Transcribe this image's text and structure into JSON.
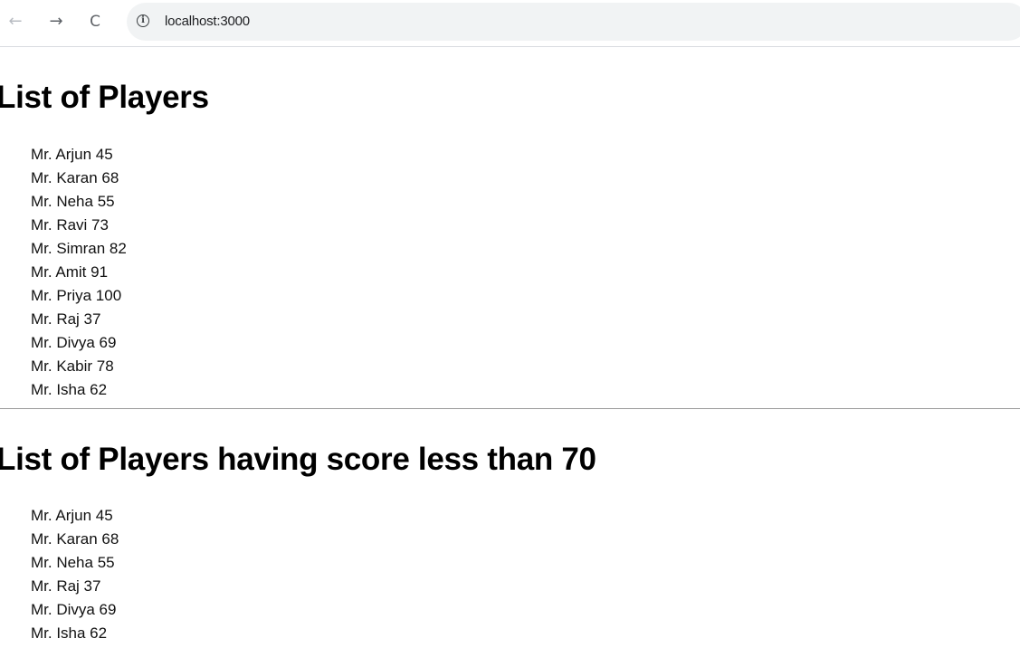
{
  "browser": {
    "back_icon": "←",
    "forward_icon": "→",
    "reload_icon": "C",
    "info_icon": "i",
    "url": "localhost:3000"
  },
  "sections": [
    {
      "title": "List of Players",
      "players": [
        "Mr. Arjun 45",
        "Mr. Karan 68",
        "Mr. Neha 55",
        "Mr. Ravi 73",
        "Mr. Simran 82",
        "Mr. Amit 91",
        "Mr. Priya 100",
        "Mr. Raj 37",
        "Mr. Divya 69",
        "Mr. Kabir 78",
        "Mr. Isha 62"
      ]
    },
    {
      "title": "List of Players having score less than 70",
      "players": [
        "Mr. Arjun 45",
        "Mr. Karan 68",
        "Mr. Neha 55",
        "Mr. Raj 37",
        "Mr. Divya 69",
        "Mr. Isha 62"
      ]
    }
  ]
}
